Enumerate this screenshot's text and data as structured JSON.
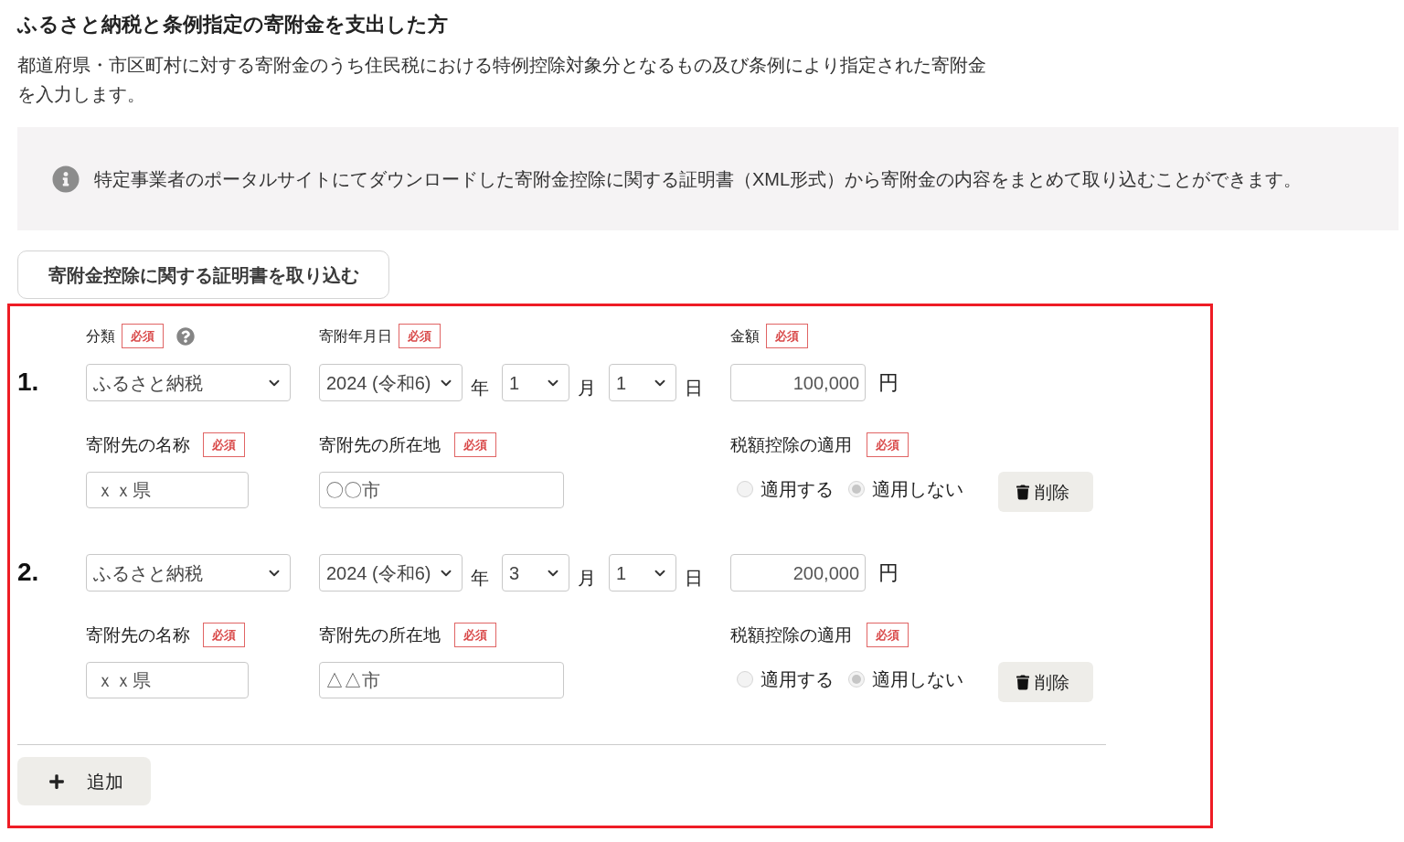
{
  "heading": "ふるさと納税と条例指定の寄附金を支出した方",
  "description": "都道府県・市区町村に対する寄附金のうち住民税における特例控除対象分となるもの及び条例により指定された寄附金を入力します。",
  "info_notice": {
    "text": "特定事業者のポータルサイトにてダウンロードした寄附金控除に関する証明書（XML形式）から寄附金の内容をまとめて取り込むことができます。"
  },
  "import_button": "寄附金控除に関する証明書を取り込む",
  "form": {
    "header": [
      {
        "label": "分類",
        "badge": "必須",
        "help": true
      },
      {
        "label": "寄附年月日",
        "badge": "必須",
        "help": false
      },
      {
        "label": "金額",
        "badge": "必須",
        "help": false
      }
    ],
    "records": [
      {
        "number": "1.",
        "category": "ふるさと納税",
        "date": {
          "year": "2024 (令和6)",
          "year_unit": "年",
          "month": "1",
          "month_unit": "月",
          "day": "1",
          "day_unit": "日"
        },
        "amount": {
          "value": "100,000",
          "unit": "円"
        },
        "name": {
          "label": "寄附先の名称",
          "badge": "必須",
          "value": "ｘｘ県"
        },
        "location": {
          "label": "寄附先の所在地",
          "badge": "必須",
          "value": "〇〇市"
        },
        "tax_credit": {
          "label": "税額控除の適用",
          "badge": "必須",
          "disabled": true,
          "options": [
            {
              "label": "適用する",
              "selected": false
            },
            {
              "label": "適用しない",
              "selected": true
            }
          ]
        },
        "delete_button": "削除"
      },
      {
        "number": "2.",
        "category": "ふるさと納税",
        "date": {
          "year": "2024 (令和6)",
          "year_unit": "年",
          "month": "3",
          "month_unit": "月",
          "day": "1",
          "day_unit": "日"
        },
        "amount": {
          "value": "200,000",
          "unit": "円"
        },
        "name": {
          "label": "寄附先の名称",
          "badge": "必須",
          "value": "ｘｘ県"
        },
        "location": {
          "label": "寄附先の所在地",
          "badge": "必須",
          "value": "△△市"
        },
        "tax_credit": {
          "label": "税額控除の適用",
          "badge": "必須",
          "disabled": true,
          "options": [
            {
              "label": "適用する",
              "selected": false
            },
            {
              "label": "適用しない",
              "selected": true
            }
          ]
        },
        "delete_button": "削除"
      }
    ],
    "add_button": "追加"
  }
}
